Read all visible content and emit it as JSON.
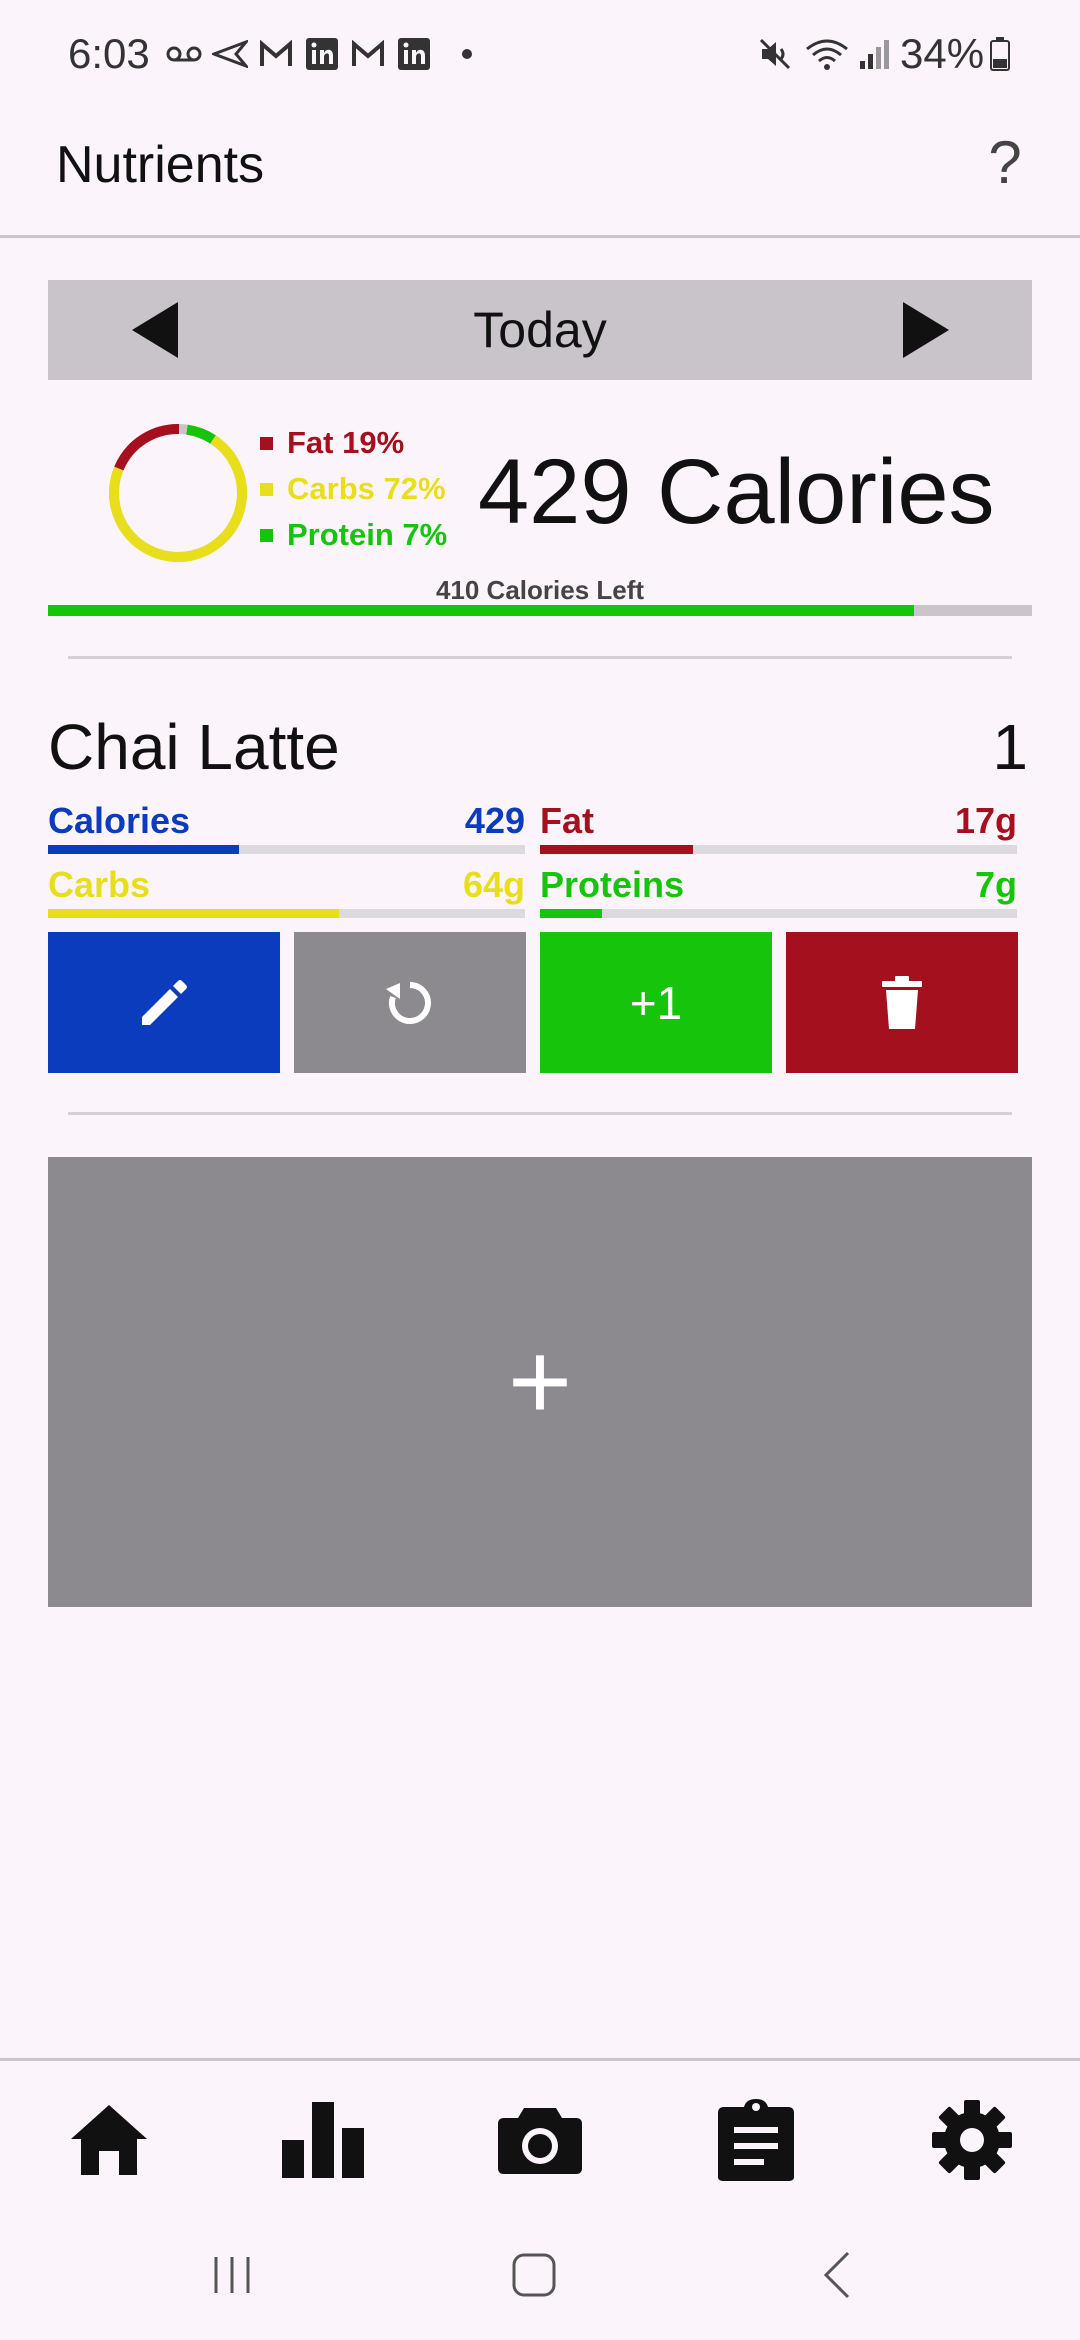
{
  "status_bar": {
    "time": "6:03",
    "battery": "34%",
    "icons": [
      "voicemail-icon",
      "send-icon",
      "gmail-icon",
      "linkedin-icon",
      "gmail-icon",
      "linkedin-icon",
      "dot-icon",
      "mute-icon",
      "wifi-icon",
      "signal-icon",
      "battery-icon"
    ]
  },
  "app_bar": {
    "title": "Nutrients",
    "help_label": "?"
  },
  "date_nav": {
    "label": "Today"
  },
  "summary": {
    "legend": [
      {
        "label": "Fat 19%",
        "color": "#a4101e",
        "percent": 19
      },
      {
        "label": "Carbs 72%",
        "color": "#e8de1c",
        "percent": 72
      },
      {
        "label": "Protein 7%",
        "color": "#16c40c",
        "percent": 7
      }
    ],
    "total_calories": "429 Calories",
    "calories_left": "410 Calories Left",
    "calorie_progress_percent": 88
  },
  "food_entry": {
    "name": "Chai Latte",
    "quantity": "1",
    "nutrients": [
      {
        "label": "Calories",
        "value": "429",
        "color": "#0a3cbd",
        "fill_percent": 40
      },
      {
        "label": "Fat",
        "value": "17g",
        "color": "#a4101e",
        "fill_percent": 32
      },
      {
        "label": "Carbs",
        "value": "64g",
        "color": "#e8de1c",
        "fill_percent": 61
      },
      {
        "label": "Proteins",
        "value": "7g",
        "color": "#16c40c",
        "fill_percent": 13
      }
    ],
    "actions": {
      "edit_icon": "pencil-icon",
      "reset_icon": "refresh-icon",
      "increment_label": "+1",
      "delete_icon": "trash-icon"
    }
  },
  "add_food": {
    "label": "+"
  },
  "bottom_nav": {
    "items": [
      "home-icon",
      "bar-chart-icon",
      "camera-icon",
      "clipboard-icon",
      "gear-icon"
    ]
  },
  "colors": {
    "background": "#fcf4fb",
    "edit": "#0a3cbd",
    "reset": "#8d8a8f",
    "increment": "#16c40c",
    "delete": "#a4101e"
  }
}
